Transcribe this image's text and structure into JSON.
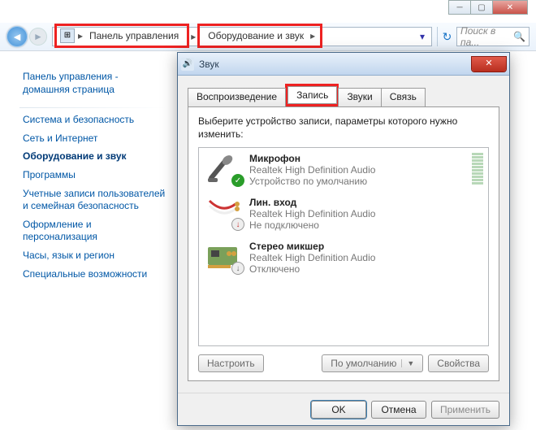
{
  "window_controls": {
    "min": "─",
    "max": "▢",
    "close": "✕"
  },
  "breadcrumb": {
    "items": [
      "Панель управления",
      "Оборудование и звук"
    ]
  },
  "search": {
    "placeholder": "Поиск в па..."
  },
  "sidebar": {
    "home": "Панель управления - домашняя страница",
    "items": [
      {
        "label": "Система и безопасность",
        "bold": false
      },
      {
        "label": "Сеть и Интернет",
        "bold": false
      },
      {
        "label": "Оборудование и звук",
        "bold": true
      },
      {
        "label": "Программы",
        "bold": false
      },
      {
        "label": "Учетные записи пользователей и семейная безопасность",
        "bold": false
      },
      {
        "label": "Оформление и персонализация",
        "bold": false
      },
      {
        "label": "Часы, язык и регион",
        "bold": false
      },
      {
        "label": "Специальные возможности",
        "bold": false
      }
    ]
  },
  "dialog": {
    "title": "Звук",
    "tabs": [
      "Воспроизведение",
      "Запись",
      "Звуки",
      "Связь"
    ],
    "active_tab": 1,
    "instruction": "Выберите устройство записи, параметры которого нужно изменить:",
    "devices": [
      {
        "name": "Микрофон",
        "sub": "Realtek High Definition Audio",
        "status": "Устройство по умолчанию",
        "icon": "mic",
        "badge": "check",
        "level": true
      },
      {
        "name": "Лин. вход",
        "sub": "Realtek High Definition Audio",
        "status": "Не подключено",
        "icon": "cable",
        "badge": "down",
        "level": false
      },
      {
        "name": "Стерео микшер",
        "sub": "Realtek High Definition Audio",
        "status": "Отключено",
        "icon": "card",
        "badge": "down",
        "level": false
      }
    ],
    "buttons": {
      "configure": "Настроить",
      "default": "По умолчанию",
      "properties": "Свойства",
      "ok": "OK",
      "cancel": "Отмена",
      "apply": "Применить"
    }
  }
}
